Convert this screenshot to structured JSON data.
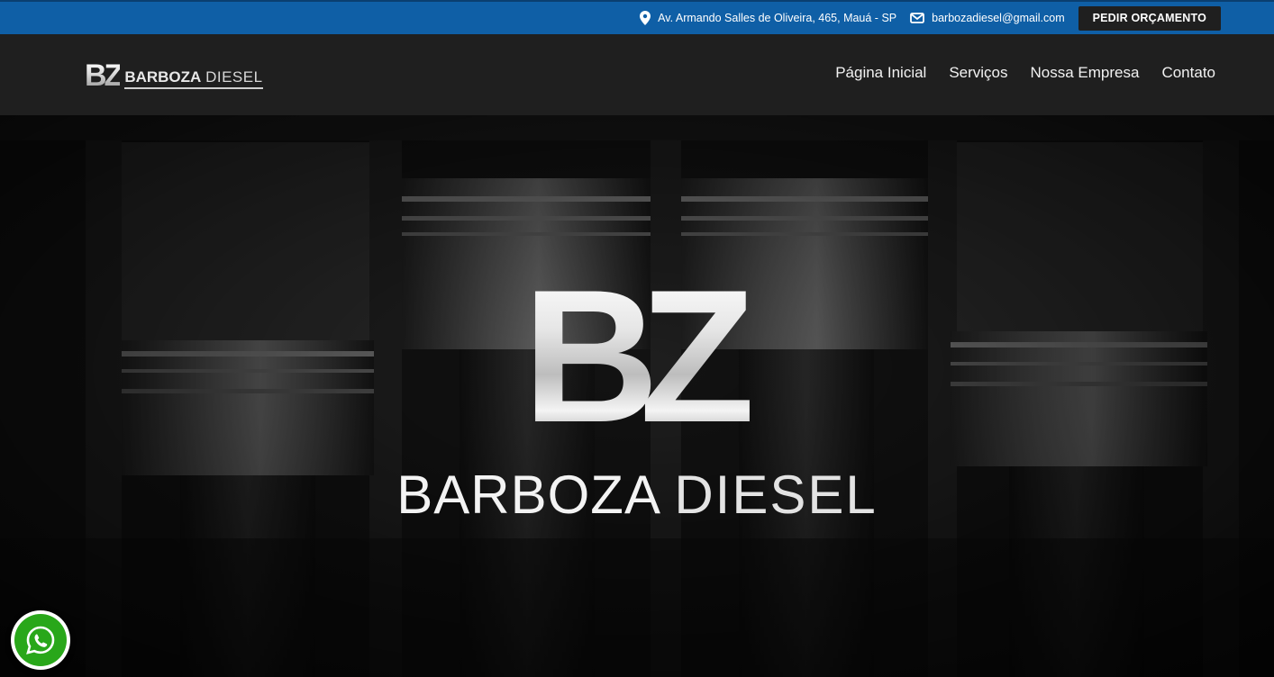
{
  "topbar": {
    "address": "Av. Armando Salles de Oliveira, 465, Mauá - SP",
    "address_icon": "map-pin-icon",
    "email": "barbozadiesel@gmail.com",
    "email_icon": "envelope-icon",
    "cta_label": "PEDIR ORÇAMENTO",
    "background_color": "#0f5fa6"
  },
  "header": {
    "logo": {
      "mark": "BZ",
      "name_bold": "BARBOZA",
      "name_light": "DIESEL"
    },
    "nav": [
      {
        "label": "Página Inicial"
      },
      {
        "label": "Serviços"
      },
      {
        "label": "Nossa Empresa"
      },
      {
        "label": "Contato"
      }
    ],
    "background_color": "#1f1f1f"
  },
  "hero": {
    "mark": "BZ",
    "title_bold": "BARBOZA",
    "title_light": "DIESEL",
    "background_icon": "engine-pistons-photo"
  },
  "whatsapp": {
    "icon": "whatsapp-icon",
    "color": "#29a71a"
  }
}
